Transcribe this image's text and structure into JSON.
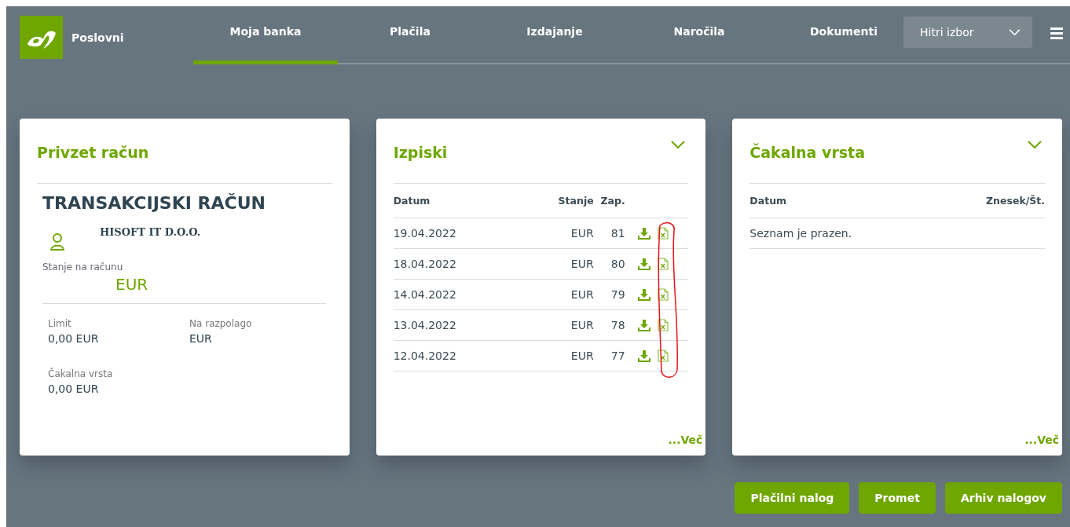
{
  "brand": {
    "label": "Poslovni"
  },
  "nav": [
    {
      "label": "Moja banka",
      "selected": true
    },
    {
      "label": "Plačila",
      "selected": false
    },
    {
      "label": "Izdajanje",
      "selected": false
    },
    {
      "label": "Naročila",
      "selected": false
    },
    {
      "label": "Dokumenti",
      "selected": false
    }
  ],
  "quick_select": {
    "label": "Hitri izbor"
  },
  "account_card": {
    "title": "Privzet račun",
    "account_type": "TRANSAKCIJSKI RAČUN",
    "owner": "HISOFT IT D.O.O.",
    "balance_label": "Stanje na računu",
    "balance": "EUR",
    "details": [
      {
        "label": "Limit",
        "value": "0,00 EUR"
      },
      {
        "label": "Na razpolago",
        "value": "EUR"
      },
      {
        "label": "Čakalna vrsta",
        "value": "0,00 EUR"
      }
    ]
  },
  "statements_card": {
    "title": "Izpiski",
    "columns": [
      "Datum",
      "Stanje",
      "Zap."
    ],
    "rows": [
      {
        "date": "19.04.2022",
        "balance": "EUR",
        "number": "81"
      },
      {
        "date": "18.04.2022",
        "balance": "EUR",
        "number": "80"
      },
      {
        "date": "14.04.2022",
        "balance": "EUR",
        "number": "79"
      },
      {
        "date": "13.04.2022",
        "balance": "EUR",
        "number": "78"
      },
      {
        "date": "12.04.2022",
        "balance": "EUR",
        "number": "77"
      }
    ],
    "more": "...Več"
  },
  "queue_card": {
    "title": "Čakalna vrsta",
    "columns": [
      "Datum",
      "Znesek/Št."
    ],
    "empty": "Seznam je prazen.",
    "more": "...Več"
  },
  "actions": [
    "Plačilni nalog",
    "Promet",
    "Arhiv nalogov"
  ]
}
